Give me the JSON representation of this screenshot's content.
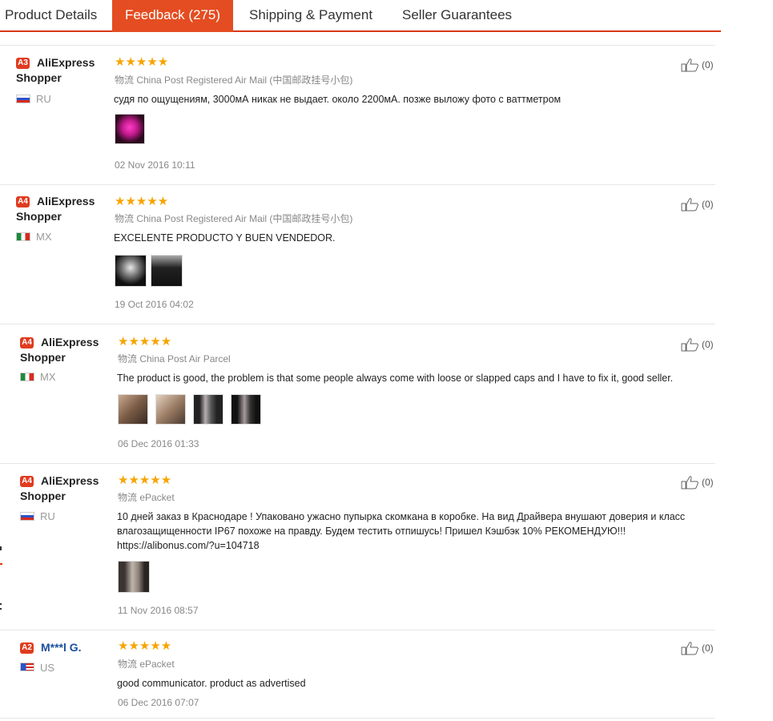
{
  "tabs": [
    {
      "label": "Product Details"
    },
    {
      "label": "Feedback (275)"
    },
    {
      "label": "Shipping & Payment"
    },
    {
      "label": "Seller Guarantees"
    }
  ],
  "reviews": [
    {
      "level": "A3",
      "name": "AliExpress Shopper",
      "country": "RU",
      "shipping": "物流 China Post Registered Air Mail (中国邮政挂号小包)",
      "text": "судя по ощущениям, 3000мА никак не выдает. около 2200мА. позже выложу фото с ваттметром",
      "date": "02 Nov 2016 10:11",
      "likes": "(0)",
      "rating": 5
    },
    {
      "level": "A4",
      "name": "AliExpress Shopper",
      "country": "MX",
      "shipping": "物流 China Post Registered Air Mail (中国邮政挂号小包)",
      "text": "EXCELENTE PRODUCTO Y BUEN VENDEDOR.",
      "date": "19 Oct 2016 04:02",
      "likes": "(0)",
      "rating": 5
    },
    {
      "level": "A4",
      "name": "AliExpress Shopper",
      "country": "MX",
      "shipping": "物流 China Post Air Parcel",
      "text": "The product is good, the problem is that some people always come with loose or slapped caps and I have to fix it, good seller.",
      "date": "06 Dec 2016 01:33",
      "likes": "(0)",
      "rating": 5
    },
    {
      "level": "A4",
      "name": "AliExpress Shopper",
      "country": "RU",
      "shipping": "物流 ePacket",
      "text_lines": [
        "10 дней заказ в Краснодаре ! Упаковано ужасно пупырка скомкана в коробке. На вид Драйвера внушают доверия и класс",
        "влагозащищенности IP67 похоже на правду. Будем тестить отпишусь! Пришел Кэшбэк 10% РЕКОМЕНДУЮ!!!",
        "https://alibonus.com/?u=104718"
      ],
      "date": "11 Nov 2016 08:57",
      "likes": "(0)",
      "rating": 5
    },
    {
      "level": "A2",
      "name": "M***l G.",
      "country": "US",
      "shipping": "物流 ePacket",
      "text": "good communicator. product as advertised",
      "date": "06 Dec 2016 07:07",
      "likes": "(0)",
      "rating": 5
    }
  ],
  "icons": {
    "star": "star-icon",
    "like": "thumbs-up-icon",
    "flags": [
      "russia-flag-icon",
      "mexico-flag-icon",
      "mexico-flag-icon",
      "russia-flag-icon",
      "usa-flag-icon"
    ]
  },
  "colors": {
    "accent": "#e44d21",
    "star": "#f7a400",
    "badge": "#e03b1f"
  }
}
